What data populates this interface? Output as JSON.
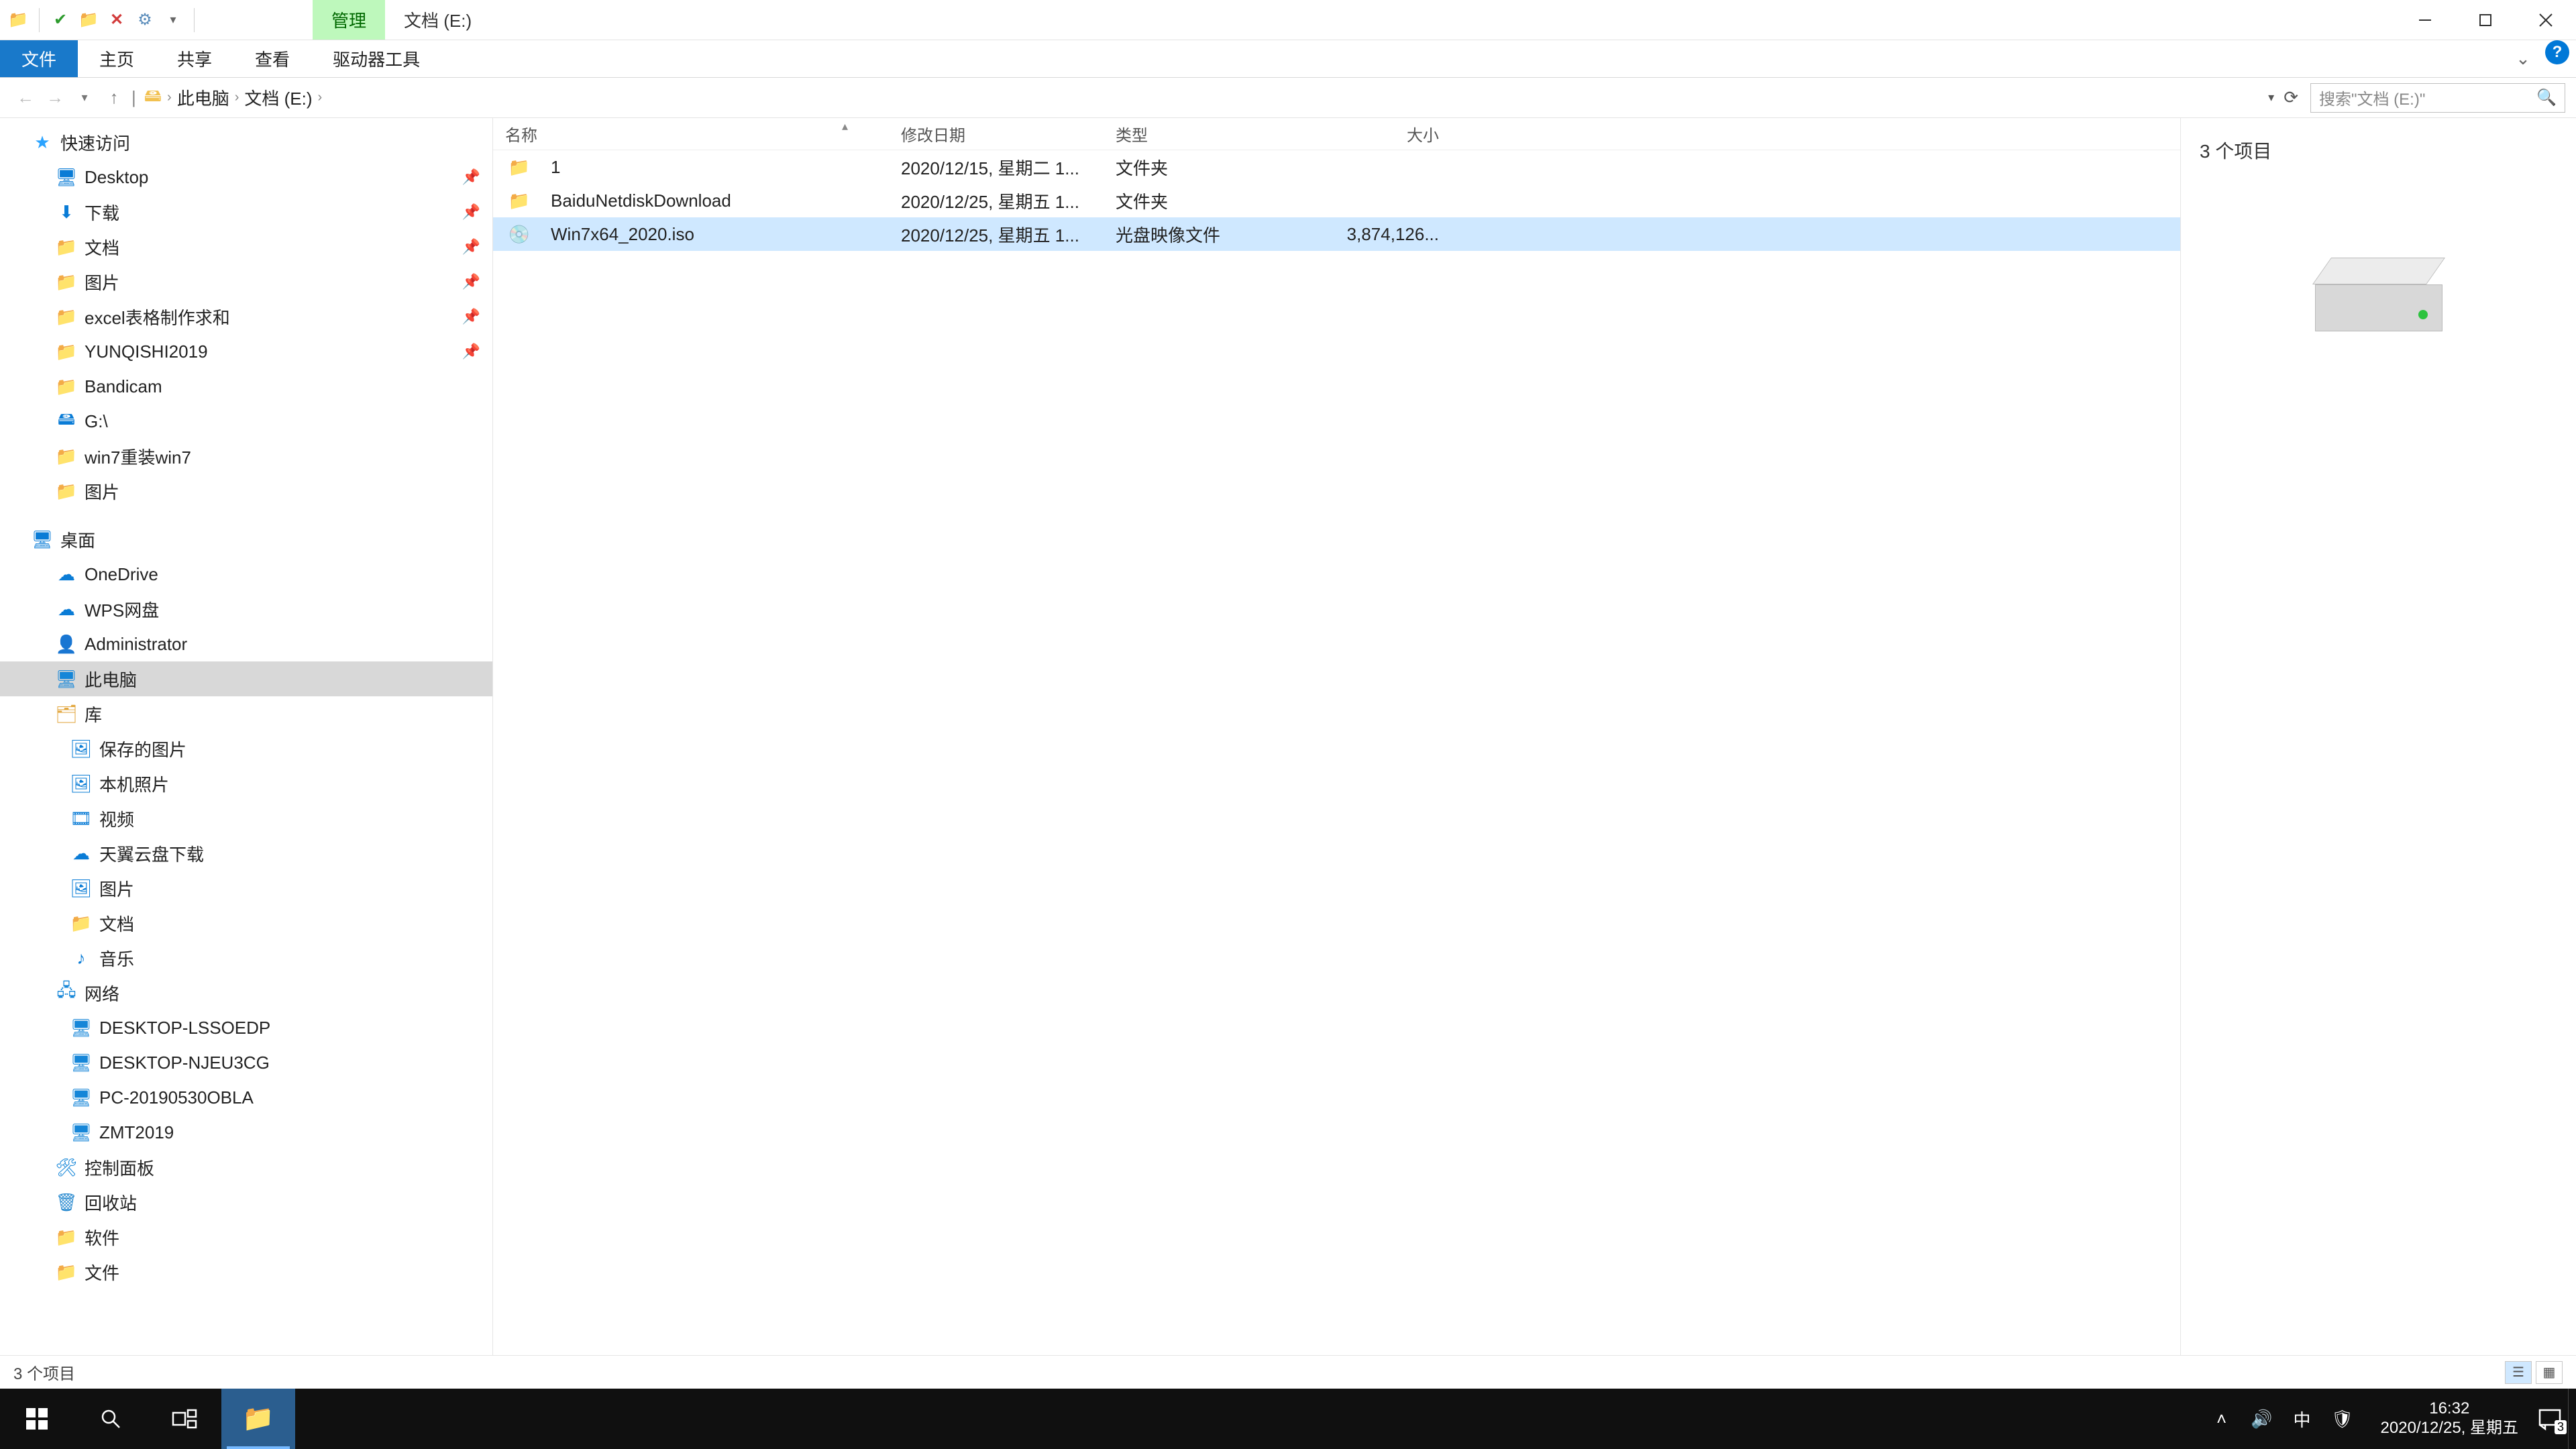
{
  "titlebar": {
    "ribbon_context_label": "管理",
    "window_title": "文档 (E:)"
  },
  "ribbon": {
    "tabs": [
      "文件",
      "主页",
      "共享",
      "查看",
      "驱动器工具"
    ]
  },
  "breadcrumb": {
    "segments": [
      "此电脑",
      "文档 (E:)"
    ]
  },
  "search": {
    "placeholder": "搜索\"文档 (E:)\""
  },
  "sidebar": {
    "quick_access": "快速访问",
    "quick_items": [
      {
        "label": "Desktop"
      },
      {
        "label": "下载"
      },
      {
        "label": "文档"
      },
      {
        "label": "图片"
      },
      {
        "label": "excel表格制作求和"
      },
      {
        "label": "YUNQISHI2019"
      },
      {
        "label": "Bandicam"
      },
      {
        "label": "G:\\"
      },
      {
        "label": "win7重装win7"
      },
      {
        "label": "图片"
      }
    ],
    "desktop": "桌面",
    "desktop_items": [
      {
        "label": "OneDrive",
        "kind": "cloud"
      },
      {
        "label": "WPS网盘",
        "kind": "cloud"
      },
      {
        "label": "Administrator",
        "kind": "user"
      },
      {
        "label": "此电脑",
        "kind": "pc",
        "selected": true
      },
      {
        "label": "库",
        "kind": "lib"
      }
    ],
    "lib_items": [
      {
        "label": "保存的图片"
      },
      {
        "label": "本机照片"
      },
      {
        "label": "视频"
      },
      {
        "label": "天翼云盘下载"
      },
      {
        "label": "图片"
      },
      {
        "label": "文档"
      },
      {
        "label": "音乐"
      }
    ],
    "network": "网络",
    "network_items": [
      {
        "label": "DESKTOP-LSSOEDP"
      },
      {
        "label": "DESKTOP-NJEU3CG"
      },
      {
        "label": "PC-20190530OBLA"
      },
      {
        "label": "ZMT2019"
      }
    ],
    "tail_items": [
      {
        "label": "控制面板",
        "kind": "panel"
      },
      {
        "label": "回收站",
        "kind": "recycle"
      },
      {
        "label": "软件",
        "kind": "folder"
      },
      {
        "label": "文件",
        "kind": "folder"
      }
    ]
  },
  "columns": {
    "name": "名称",
    "date": "修改日期",
    "type": "类型",
    "size": "大小"
  },
  "files": [
    {
      "name": "1",
      "date": "2020/12/15, 星期二 1...",
      "type": "文件夹",
      "size": "",
      "kind": "folder"
    },
    {
      "name": "BaiduNetdiskDownload",
      "date": "2020/12/25, 星期五 1...",
      "type": "文件夹",
      "size": "",
      "kind": "folder"
    },
    {
      "name": "Win7x64_2020.iso",
      "date": "2020/12/25, 星期五 1...",
      "type": "光盘映像文件",
      "size": "3,874,126...",
      "kind": "disc",
      "selected": true
    }
  ],
  "preview": {
    "count_label": "3 个项目"
  },
  "statusbar": {
    "text": "3 个项目"
  },
  "taskbar": {
    "time": "16:32",
    "date": "2020/12/25, 星期五",
    "ime": "中",
    "action_badge": "3"
  }
}
